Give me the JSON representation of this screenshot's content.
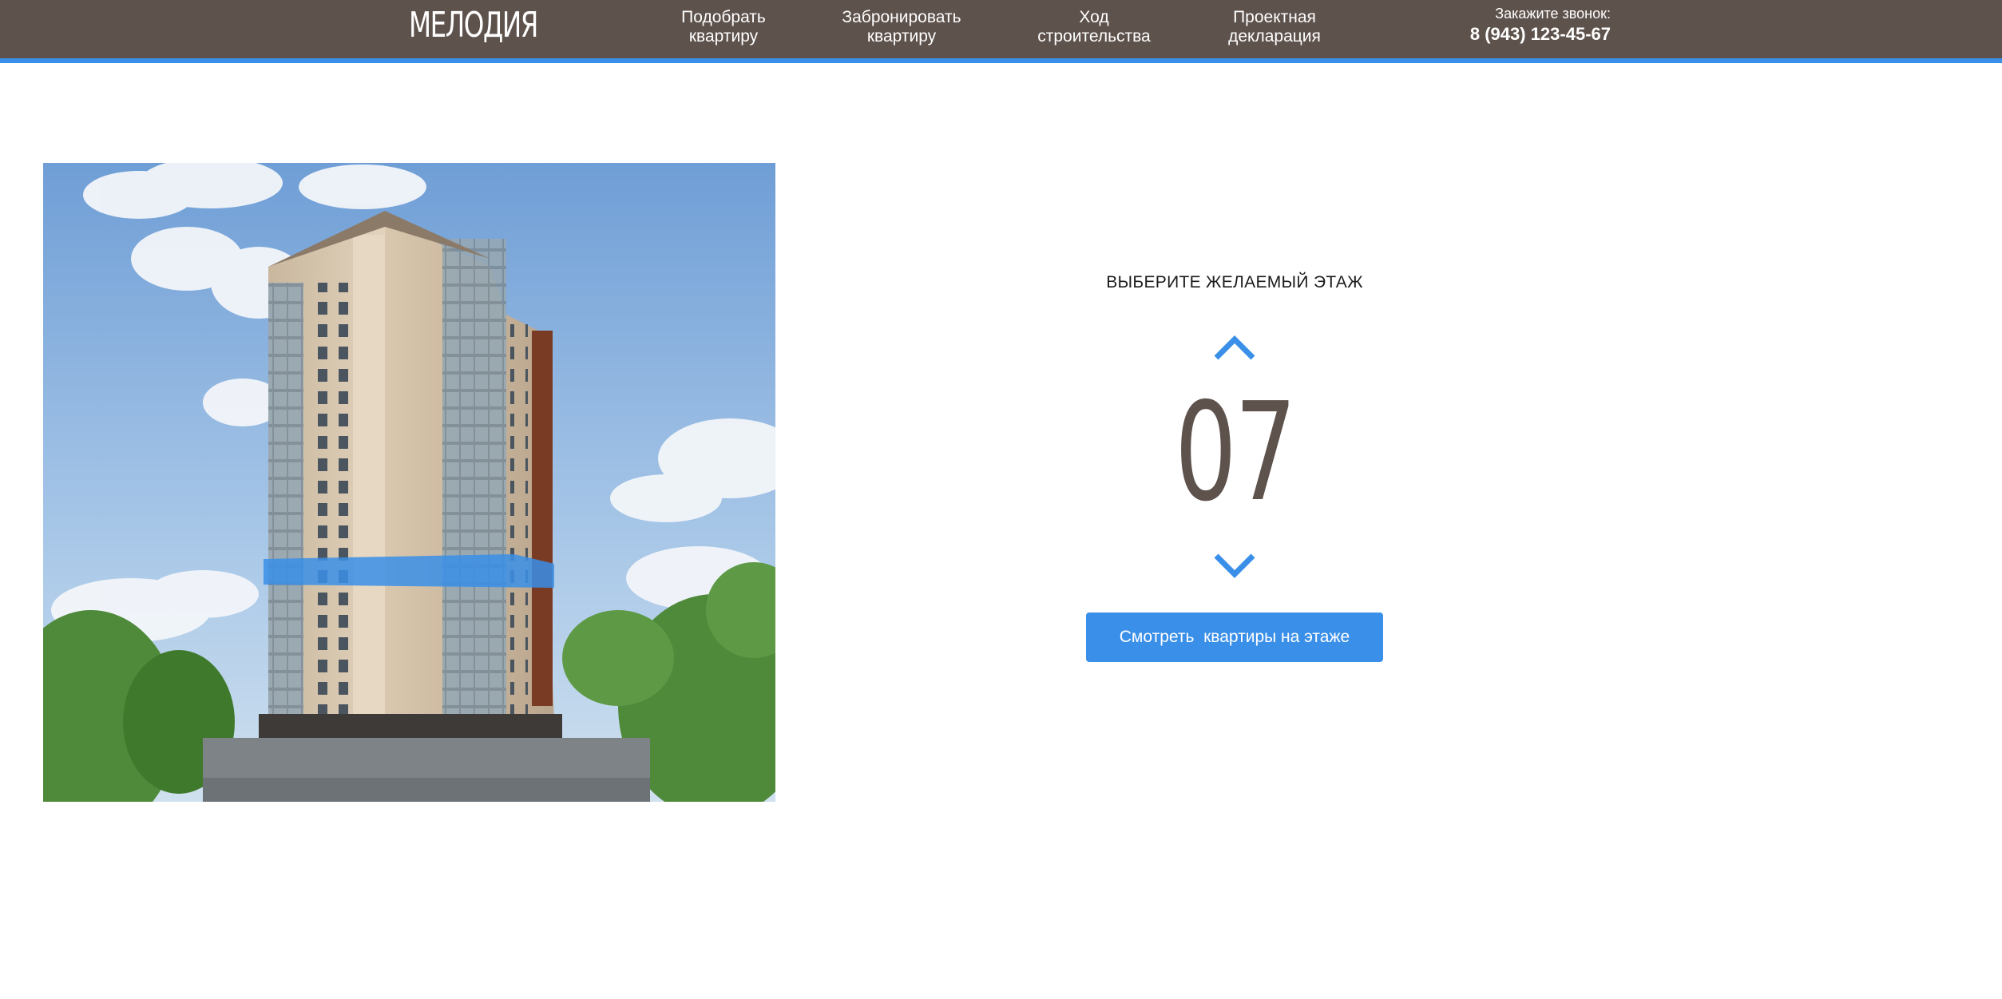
{
  "header": {
    "logo": "МЕЛОДИЯ",
    "nav": [
      {
        "line1": "Подобрать",
        "line2": "квартиру"
      },
      {
        "line1": "Забронировать",
        "line2": "квартиру"
      },
      {
        "line1": "Ход",
        "line2": "строительства"
      },
      {
        "line1": "Проектная",
        "line2": "декларация"
      }
    ],
    "callback_label": "Закажите звонок:",
    "phone": "8 (943) 123-45-67"
  },
  "picker": {
    "title": "ВЫБЕРИТЕ ЖЕЛАЕМЫЙ ЭТАЖ",
    "floor": "07",
    "button_label": "Смотреть  квартиры на этаже"
  },
  "colors": {
    "header_bg": "#5e524c",
    "accent": "#3a8fe8",
    "floor_number": "#5e524c"
  },
  "icons": {
    "up": "chevron-up-icon",
    "down": "chevron-down-icon"
  }
}
